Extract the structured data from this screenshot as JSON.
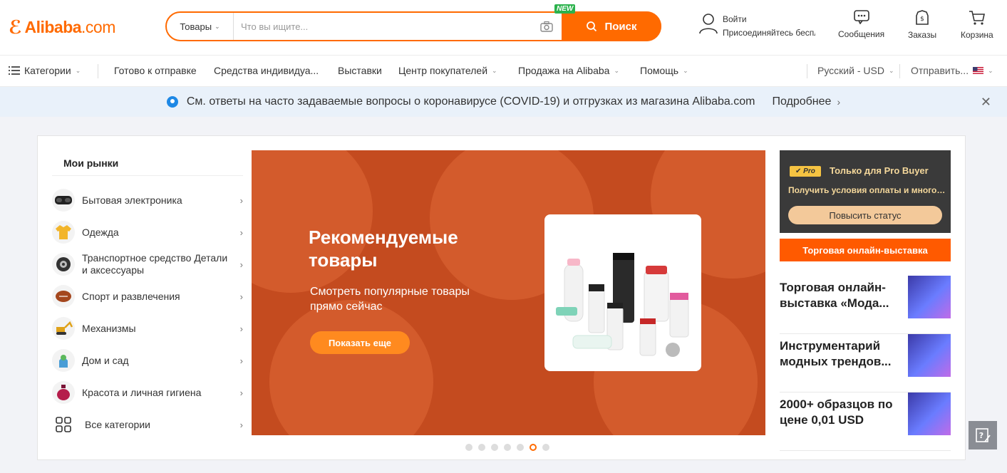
{
  "header": {
    "logo_text": "Alibaba",
    "logo_domain": ".com",
    "search": {
      "category": "Товары",
      "placeholder": "Что вы ищите...",
      "new_badge": "NEW",
      "button_label": "Поиск"
    },
    "signin": {
      "line1": "Войти",
      "line2": "Присоединяйтесь бесплатно"
    },
    "messages_label": "Сообщения",
    "orders_label": "Заказы",
    "cart_label": "Корзина",
    "accent_color": "#ff6a00"
  },
  "nav": {
    "categories_label": "Категории",
    "items": [
      "Готово к отправке",
      "Средства индивидуа...",
      "Выставки",
      "Центр покупателей",
      "Продажа на Alibaba",
      "Помощь"
    ],
    "language_currency": "Русский - USD",
    "ship_to": "Отправить..."
  },
  "notice": {
    "text": "См. ответы на часто задаваемые вопросы о коронавирусе (COVID-19) и отгрузках из магазина Alibaba.com",
    "link_label": "Подробнее"
  },
  "markets": {
    "title": "Мои рынки",
    "items": [
      {
        "label": "Бытовая электроника",
        "icon": "vr-headset-icon"
      },
      {
        "label": "Одежда",
        "icon": "tshirt-icon"
      },
      {
        "label": "Транспортное средство Детали и аксессуары",
        "icon": "wheel-icon"
      },
      {
        "label": "Спорт и развлечения",
        "icon": "sports-ball-icon"
      },
      {
        "label": "Механизмы",
        "icon": "excavator-icon"
      },
      {
        "label": "Дом и сад",
        "icon": "home-garden-icon"
      },
      {
        "label": "Красота и личная гигиена",
        "icon": "perfume-icon"
      },
      {
        "label": "Все категории",
        "icon": "grid-icon"
      }
    ]
  },
  "banner": {
    "title": "Рекомендуемые товары",
    "subtitle": "Смотреть популярные товары прямо сейчас",
    "cta_label": "Показать еще",
    "slides_total": 7,
    "active_slide": 6
  },
  "pro_buyer": {
    "badge": "Pro",
    "title": "Только для Pro Buyer",
    "subtitle": "Получить условия оплаты и многое другое",
    "button_label": "Повысить статус"
  },
  "expo_label": "Торговая онлайн-выставка",
  "features": [
    {
      "title": "Торговая онлайн-выставка «Мода..."
    },
    {
      "title": "Инструментарий модных трендов..."
    },
    {
      "title": "2000+ образцов по цене 0,01 USD"
    }
  ]
}
